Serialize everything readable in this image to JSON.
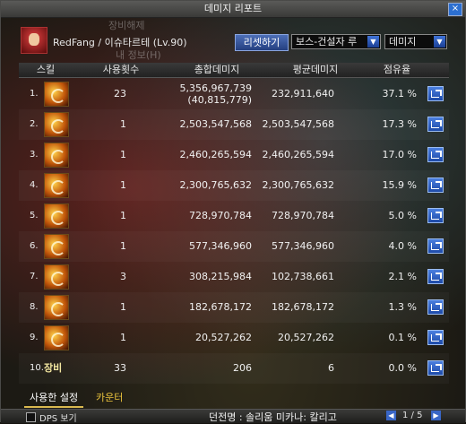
{
  "window": {
    "title": "데미지 리포트",
    "close_label": "×"
  },
  "header": {
    "character": "RedFang / 이슈타르테 (Lv.90)",
    "ghost_unequip": "장비해제",
    "ghost_myinfo": "내 정보(H)",
    "reset_label": "리셋하기",
    "target_select": "보스-건설자 루",
    "stat_select": "데미지"
  },
  "columns": [
    "스킬",
    "사용횟수",
    "총합데미지",
    "평균데미지",
    "점유율"
  ],
  "rows": [
    {
      "rank": "1.",
      "count": "23",
      "total": "5,356,967,739",
      "total_sub": "(40,815,779)",
      "avg": "232,911,640",
      "pct": "37.1",
      "unit": "%"
    },
    {
      "rank": "2.",
      "count": "1",
      "total": "2,503,547,568",
      "total_sub": "",
      "avg": "2,503,547,568",
      "pct": "17.3",
      "unit": "%"
    },
    {
      "rank": "3.",
      "count": "1",
      "total": "2,460,265,594",
      "total_sub": "",
      "avg": "2,460,265,594",
      "pct": "17.0",
      "unit": "%"
    },
    {
      "rank": "4.",
      "count": "1",
      "total": "2,300,765,632",
      "total_sub": "",
      "avg": "2,300,765,632",
      "pct": "15.9",
      "unit": "%"
    },
    {
      "rank": "5.",
      "count": "1",
      "total": "728,970,784",
      "total_sub": "",
      "avg": "728,970,784",
      "pct": "5.0",
      "unit": "%"
    },
    {
      "rank": "6.",
      "count": "1",
      "total": "577,346,960",
      "total_sub": "",
      "avg": "577,346,960",
      "pct": "4.0",
      "unit": "%"
    },
    {
      "rank": "7.",
      "count": "3",
      "total": "308,215,984",
      "total_sub": "",
      "avg": "102,738,661",
      "pct": "2.1",
      "unit": "%"
    },
    {
      "rank": "8.",
      "count": "1",
      "total": "182,678,172",
      "total_sub": "",
      "avg": "182,678,172",
      "pct": "1.3",
      "unit": "%"
    },
    {
      "rank": "9.",
      "count": "1",
      "total": "20,527,262",
      "total_sub": "",
      "avg": "20,527,262",
      "pct": "0.1",
      "unit": "%"
    },
    {
      "rank": "10.",
      "skill_label": "장비",
      "count": "33",
      "total": "206",
      "total_sub": "",
      "avg": "6",
      "pct": "0.0",
      "unit": "%"
    }
  ],
  "tabs": [
    "사용한 설정",
    "카운터"
  ],
  "footer": {
    "dps_label": "DPS 보기",
    "dungeon": "던전명 : 솔리움 미카나: 칼리고",
    "page": "1 / 5"
  },
  "icons": {
    "share": "share-arrow-icon",
    "skill": "skill-icon"
  },
  "colors": {
    "accent": "#2c5fc8",
    "tab_text": "#e9c23c"
  }
}
